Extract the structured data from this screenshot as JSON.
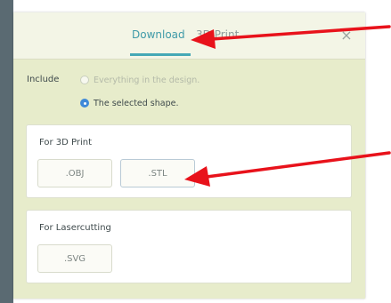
{
  "dialog": {
    "tabs": [
      {
        "label": "Download",
        "active": true
      },
      {
        "label": "3D Print",
        "active": false
      }
    ],
    "close_symbol": "×",
    "include": {
      "label": "Include",
      "options": [
        {
          "label": "Everything in the design.",
          "checked": false
        },
        {
          "label": "The selected shape.",
          "checked": true
        }
      ]
    },
    "sections": {
      "print3d": {
        "title": "For 3D Print",
        "buttons": [
          ".OBJ",
          ".STL"
        ]
      },
      "laser": {
        "title": "For Lasercutting",
        "buttons": [
          ".SVG"
        ]
      }
    }
  },
  "colors": {
    "panel": "#e7eccb",
    "accent": "#45a8b6",
    "arrow": "#e8121b",
    "radio_selected": "#3f89d8"
  },
  "icons": {
    "close": "close-icon",
    "annotation": "red-arrow-icon"
  }
}
